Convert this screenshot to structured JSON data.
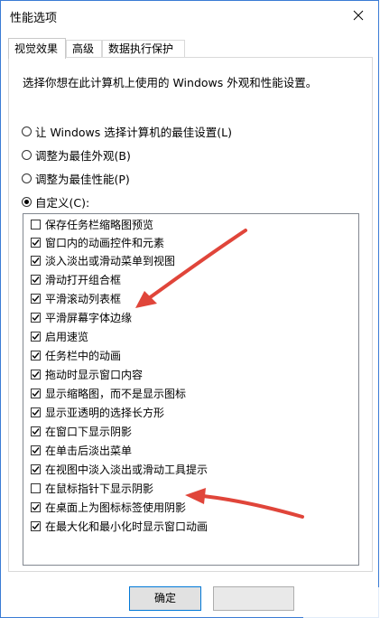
{
  "window": {
    "title": "性能选项",
    "accent": "#3a7bd5"
  },
  "tabs": [
    {
      "label": "视觉效果",
      "active": true
    },
    {
      "label": "高级",
      "active": false
    },
    {
      "label": "数据执行保护",
      "active": false
    }
  ],
  "panel": {
    "intro": "选择你想在此计算机上使用的 Windows 外观和性能设置。",
    "options": [
      {
        "label": "让 Windows 选择计算机的最佳设置(L)",
        "selected": false
      },
      {
        "label": "调整为最佳外观(B)",
        "selected": false
      },
      {
        "label": "调整为最佳性能(P)",
        "selected": false
      },
      {
        "label": "自定义(C):",
        "selected": true
      }
    ],
    "effects": [
      {
        "label": "保存任务栏缩略图预览",
        "checked": false
      },
      {
        "label": "窗口内的动画控件和元素",
        "checked": true
      },
      {
        "label": "淡入淡出或滑动菜单到视图",
        "checked": true
      },
      {
        "label": "滑动打开组合框",
        "checked": true
      },
      {
        "label": "平滑滚动列表框",
        "checked": true
      },
      {
        "label": "平滑屏幕字体边缘",
        "checked": true
      },
      {
        "label": "启用速览",
        "checked": true
      },
      {
        "label": "任务栏中的动画",
        "checked": true
      },
      {
        "label": "拖动时显示窗口内容",
        "checked": true
      },
      {
        "label": "显示缩略图，而不是显示图标",
        "checked": true
      },
      {
        "label": "显示亚透明的选择长方形",
        "checked": true
      },
      {
        "label": "在窗口下显示阴影",
        "checked": true
      },
      {
        "label": "在单击后淡出菜单",
        "checked": true
      },
      {
        "label": "在视图中淡入淡出或滑动工具提示",
        "checked": true
      },
      {
        "label": "在鼠标指针下显示阴影",
        "checked": false
      },
      {
        "label": "在桌面上为图标标签使用阴影",
        "checked": true
      },
      {
        "label": "在最大化和最小化时显示窗口动画",
        "checked": true
      }
    ]
  },
  "buttons": {
    "ok": "确定",
    "cancel": ""
  },
  "annotation_color": "#e0453a"
}
